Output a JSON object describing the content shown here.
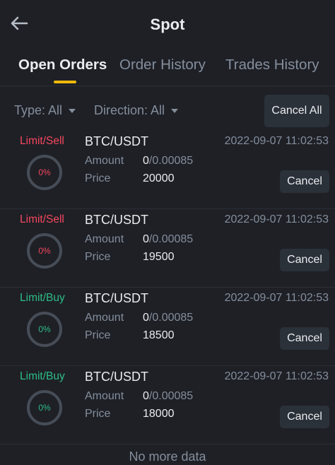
{
  "header": {
    "title": "Spot",
    "back_icon": "arrow-left-icon"
  },
  "tabs": [
    {
      "label": "Open Orders",
      "active": true
    },
    {
      "label": "Order History",
      "active": false
    },
    {
      "label": "Trades History",
      "active": false
    }
  ],
  "filters": {
    "type_label": "Type: All",
    "direction_label": "Direction: All",
    "cancel_all_label": "Cancel All"
  },
  "colors": {
    "sell": "#f6465d",
    "buy": "#2ebd85",
    "accent": "#f0b90b",
    "background": "#1e2026"
  },
  "orders": [
    {
      "side": "Limit/Sell",
      "side_type": "sell",
      "progress_label": "0%",
      "filled_fraction": 0,
      "pair": "BTC/USDT",
      "time": "2022-09-07 11:02:53",
      "amount_label": "Amount",
      "amount_filled": "0",
      "amount_total": "/0.00085",
      "price_label": "Price",
      "price": "20000",
      "cancel_label": "Cancel"
    },
    {
      "side": "Limit/Sell",
      "side_type": "sell",
      "progress_label": "0%",
      "filled_fraction": 0,
      "pair": "BTC/USDT",
      "time": "2022-09-07 11:02:53",
      "amount_label": "Amount",
      "amount_filled": "0",
      "amount_total": "/0.00085",
      "price_label": "Price",
      "price": "19500",
      "cancel_label": "Cancel"
    },
    {
      "side": "Limit/Buy",
      "side_type": "buy",
      "progress_label": "0%",
      "filled_fraction": 0,
      "pair": "BTC/USDT",
      "time": "2022-09-07 11:02:53",
      "amount_label": "Amount",
      "amount_filled": "0",
      "amount_total": "/0.00085",
      "price_label": "Price",
      "price": "18500",
      "cancel_label": "Cancel"
    },
    {
      "side": "Limit/Buy",
      "side_type": "buy",
      "progress_label": "0%",
      "filled_fraction": 0,
      "pair": "BTC/USDT",
      "time": "2022-09-07 11:02:53",
      "amount_label": "Amount",
      "amount_filled": "0",
      "amount_total": "/0.00085",
      "price_label": "Price",
      "price": "18000",
      "cancel_label": "Cancel"
    }
  ],
  "footer": {
    "no_more_text": "No more data"
  }
}
